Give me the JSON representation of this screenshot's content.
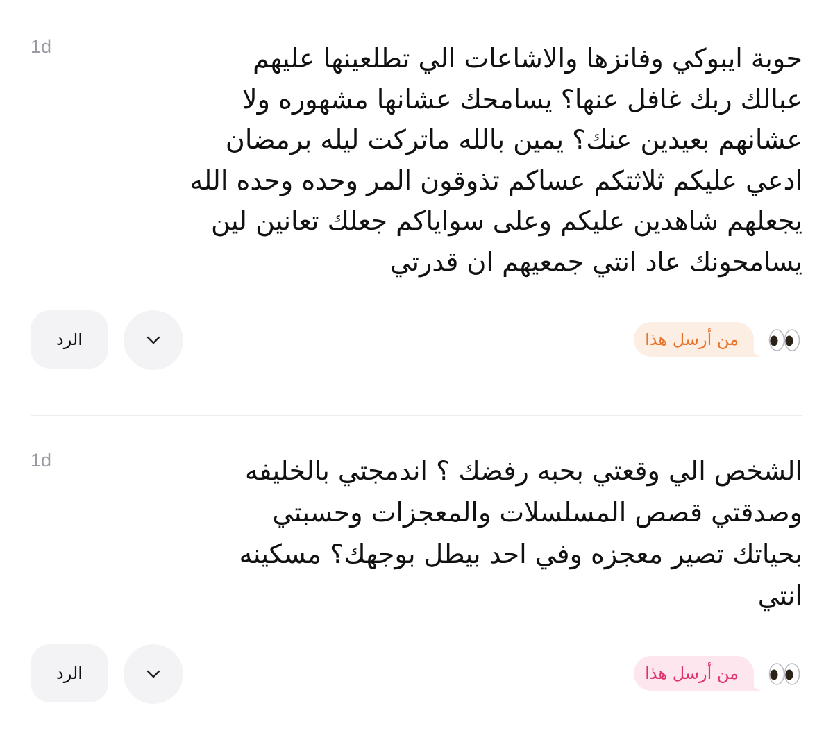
{
  "messages": [
    {
      "timestamp": "1d",
      "text": "حوبة ايبوكي وفانزها والاشاعات الي تطلعينها عليهم\nعبالك ربك غافل عنها؟ يسامحك عشانها مشهوره ولا\nعشانهم بعيدين عنك؟ يمين بالله ماتركت ليله برمضان\nادعي عليكم ثلاثتكم عساكم تذوقون المر وحده وحده الله\nيجعلهم شاهدين عليكم وعلى سواياكم جعلك تعانين لين\nيسامحونك عاد انتي جمعيهم ان قدرتي",
      "sender_label": "من أرسل هذا",
      "pill_bg": "#fdeee4",
      "pill_text": "#e8742c",
      "reply_label": "الرد",
      "expand_icon": "chevron-down-icon",
      "reaction_icon": "eyes-icon"
    },
    {
      "timestamp": "1d",
      "text": "الشخص الي وقعتي بحبه رفضك ؟ اندمجتي بالخليفه\nوصدقتي قصص المسلسلات والمعجزات وحسبتي\nبحياتك تصير معجزه وفي احد بيطل بوجهك؟ مسكينه\nانتي",
      "sender_label": "من أرسل هذا",
      "pill_bg": "#fde6ee",
      "pill_text": "#e0336e",
      "reply_label": "الرد",
      "expand_icon": "chevron-down-icon",
      "reaction_icon": "eyes-icon"
    }
  ],
  "colors": {
    "button_bg": "#f3f3f6",
    "divider": "#ececef",
    "timestamp": "#9a9aa2",
    "text": "#111111"
  }
}
